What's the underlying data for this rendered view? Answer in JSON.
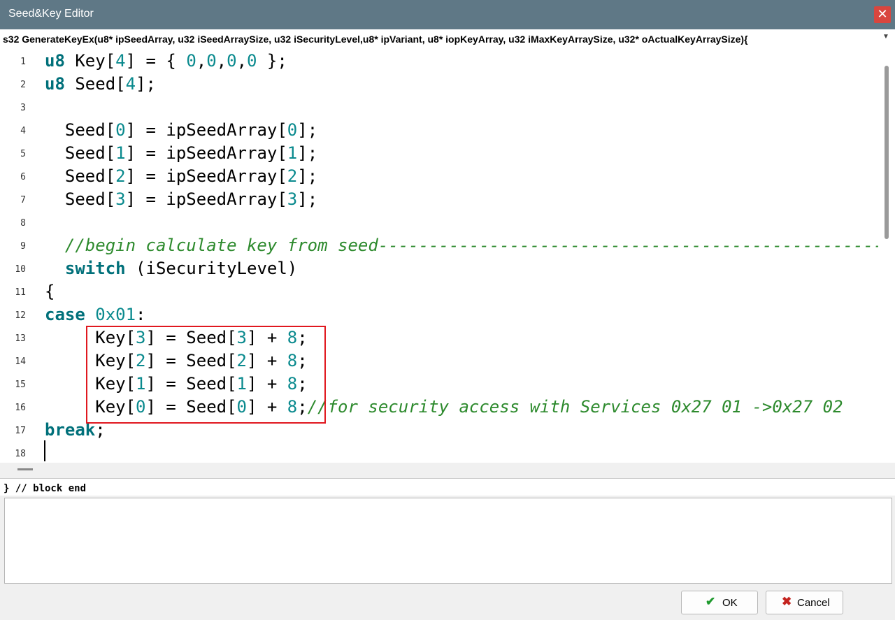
{
  "window": {
    "title": "Seed&Key Editor",
    "close_glyph": "✕"
  },
  "signature": "s32 GenerateKeyEx(u8* ipSeedArray, u32 iSeedArraySize, u32 iSecurityLevel,u8* ipVariant, u8* iopKeyArray, u32 iMaxKeyArraySize, u32* oActualKeyArraySize){",
  "line_numbers": [
    "1",
    "2",
    "3",
    "4",
    "5",
    "6",
    "7",
    "8",
    "9",
    "10",
    "11",
    "12",
    "13",
    "14",
    "15",
    "16",
    "17",
    "18"
  ],
  "code_lines": [
    [
      {
        "t": "u8",
        "c": "kw"
      },
      {
        "t": " Key["
      },
      {
        "t": "4",
        "c": "num"
      },
      {
        "t": "] = { "
      },
      {
        "t": "0",
        "c": "num"
      },
      {
        "t": ","
      },
      {
        "t": "0",
        "c": "num"
      },
      {
        "t": ","
      },
      {
        "t": "0",
        "c": "num"
      },
      {
        "t": ","
      },
      {
        "t": "0",
        "c": "num"
      },
      {
        "t": " };"
      }
    ],
    [
      {
        "t": "u8",
        "c": "kw"
      },
      {
        "t": " Seed["
      },
      {
        "t": "4",
        "c": "num"
      },
      {
        "t": "];"
      }
    ],
    [],
    [
      {
        "t": "  Seed["
      },
      {
        "t": "0",
        "c": "num"
      },
      {
        "t": "] = ipSeedArray["
      },
      {
        "t": "0",
        "c": "num"
      },
      {
        "t": "];"
      }
    ],
    [
      {
        "t": "  Seed["
      },
      {
        "t": "1",
        "c": "num"
      },
      {
        "t": "] = ipSeedArray["
      },
      {
        "t": "1",
        "c": "num"
      },
      {
        "t": "];"
      }
    ],
    [
      {
        "t": "  Seed["
      },
      {
        "t": "2",
        "c": "num"
      },
      {
        "t": "] = ipSeedArray["
      },
      {
        "t": "2",
        "c": "num"
      },
      {
        "t": "];"
      }
    ],
    [
      {
        "t": "  Seed["
      },
      {
        "t": "3",
        "c": "num"
      },
      {
        "t": "] = ipSeedArray["
      },
      {
        "t": "3",
        "c": "num"
      },
      {
        "t": "];"
      }
    ],
    [],
    [
      {
        "t": "  //begin calculate key from seed------------------------------------------------------------",
        "c": "cm"
      }
    ],
    [
      {
        "t": "  "
      },
      {
        "t": "switch",
        "c": "kw"
      },
      {
        "t": " (iSecurityLevel)"
      }
    ],
    [
      {
        "t": "{"
      }
    ],
    [
      {
        "t": "case",
        "c": "kw"
      },
      {
        "t": " "
      },
      {
        "t": "0x01",
        "c": "num"
      },
      {
        "t": ":"
      }
    ],
    [
      {
        "t": "     Key["
      },
      {
        "t": "3",
        "c": "num"
      },
      {
        "t": "] = Seed["
      },
      {
        "t": "3",
        "c": "num"
      },
      {
        "t": "] + "
      },
      {
        "t": "8",
        "c": "num"
      },
      {
        "t": ";"
      }
    ],
    [
      {
        "t": "     Key["
      },
      {
        "t": "2",
        "c": "num"
      },
      {
        "t": "] = Seed["
      },
      {
        "t": "2",
        "c": "num"
      },
      {
        "t": "] + "
      },
      {
        "t": "8",
        "c": "num"
      },
      {
        "t": ";"
      }
    ],
    [
      {
        "t": "     Key["
      },
      {
        "t": "1",
        "c": "num"
      },
      {
        "t": "] = Seed["
      },
      {
        "t": "1",
        "c": "num"
      },
      {
        "t": "] + "
      },
      {
        "t": "8",
        "c": "num"
      },
      {
        "t": ";"
      }
    ],
    [
      {
        "t": "     Key["
      },
      {
        "t": "0",
        "c": "num"
      },
      {
        "t": "] = Seed["
      },
      {
        "t": "0",
        "c": "num"
      },
      {
        "t": "] + "
      },
      {
        "t": "8",
        "c": "num"
      },
      {
        "t": ";"
      },
      {
        "t": "//for security access with Services 0x27 01 ->0x27 02",
        "c": "cm"
      }
    ],
    [
      {
        "t": "break",
        "c": "kw"
      },
      {
        "t": ";"
      }
    ],
    []
  ],
  "block_end": "} // block end",
  "buttons": {
    "ok": {
      "label": "OK",
      "icon": "check-icon",
      "glyph": "✔",
      "color": "#1f9a2e"
    },
    "cancel": {
      "label": "Cancel",
      "icon": "x-icon",
      "glyph": "✖",
      "color": "#c4231f"
    }
  },
  "colors": {
    "titlebar": "#5f7886",
    "keyword": "#00707a",
    "number": "#0a8a8e",
    "comment": "#2d8a2d",
    "highlight_box": "#e0181f"
  }
}
